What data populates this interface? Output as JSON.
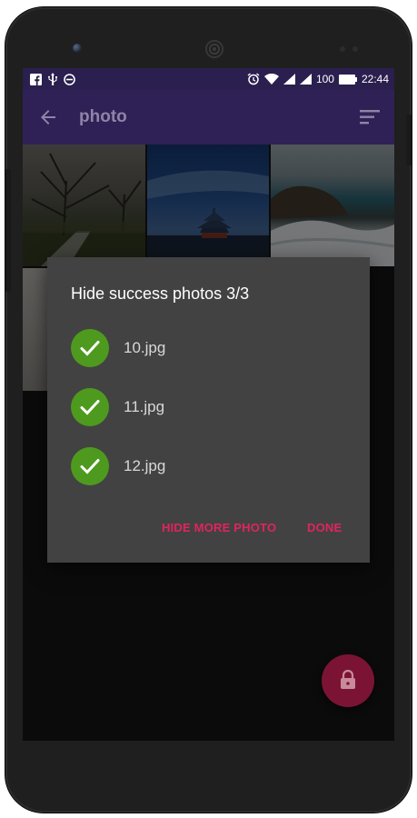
{
  "status_bar": {
    "battery_level": "100",
    "time": "22:44",
    "left_icons": [
      "facebook-icon",
      "usb-icon",
      "do-not-disturb-icon"
    ],
    "right_icons": [
      "alarm-icon",
      "wifi-icon",
      "signal-icon",
      "signal-icon",
      "battery-icon"
    ]
  },
  "app_bar": {
    "title": "photo",
    "back_icon": "arrow-left-icon",
    "sort_icon": "sort-icon"
  },
  "dialog": {
    "title": "Hide success photos 3/3",
    "items": [
      {
        "label": "10.jpg",
        "icon": "check-icon"
      },
      {
        "label": "11.jpg",
        "icon": "check-icon"
      },
      {
        "label": "12.jpg",
        "icon": "check-icon"
      }
    ],
    "buttons": {
      "hide_more": "HIDE MORE PHOTO",
      "done": "DONE"
    }
  },
  "fab": {
    "icon": "lock-icon"
  },
  "colors": {
    "status_bar": "#2a1f4f",
    "app_bar": "#2f2155",
    "dialog_bg": "#424242",
    "accent": "#e0245e",
    "check_green": "#4e9a1f",
    "fab": "#7b1434"
  }
}
